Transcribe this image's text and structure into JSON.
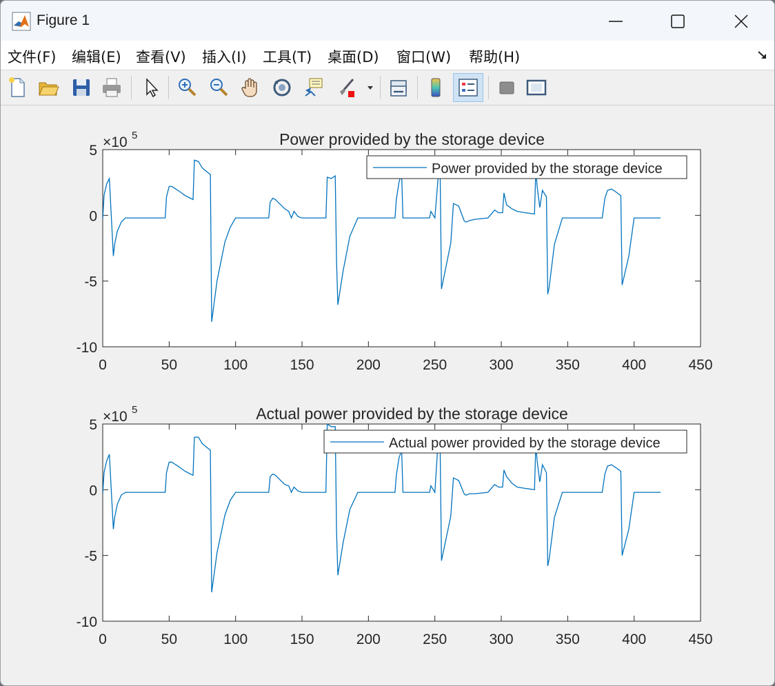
{
  "window": {
    "title": "Figure 1"
  },
  "menu": [
    "文件(F)",
    "编辑(E)",
    "查看(V)",
    "插入(I)",
    "工具(T)",
    "桌面(D)",
    "窗口(W)",
    "帮助(H)"
  ],
  "toolbar": [
    "new-figure-icon",
    "open-file-icon",
    "save-icon",
    "print-icon",
    "pointer-icon",
    "zoom-in-icon",
    "zoom-out-icon",
    "pan-icon",
    "rotate-3d-icon",
    "data-cursor-icon",
    "brush-icon",
    "link-plot-icon",
    "colorbar-icon",
    "legend-icon",
    "hide-plot-tools-icon",
    "show-plot-tools-icon"
  ],
  "colors": {
    "line": "#0072BD",
    "axes": "#262626"
  },
  "chart_data": [
    {
      "type": "line",
      "title": "Power provided by the storage device",
      "exponent_label": "×10",
      "exponent": "5",
      "legend": "top-right",
      "xlim": [
        0,
        450
      ],
      "ylim": [
        -10,
        5
      ],
      "xticks": [
        "0",
        "50",
        "100",
        "150",
        "200",
        "250",
        "300",
        "350",
        "400",
        "450"
      ],
      "yticks": [
        "-10",
        "-5",
        "0",
        "5"
      ],
      "series": [
        {
          "name": "Power provided by the storage device",
          "x": [
            0,
            1,
            2,
            3,
            5,
            8,
            9,
            11,
            14,
            17,
            20,
            30,
            40,
            47,
            48,
            50,
            52,
            55,
            58,
            62,
            66,
            68,
            69,
            72,
            75,
            81,
            82,
            86,
            92,
            96,
            100,
            110,
            120,
            125,
            126,
            128,
            130,
            133,
            137,
            140,
            142,
            144,
            147,
            150,
            160,
            168,
            169,
            172,
            175,
            176,
            177,
            181,
            186,
            192,
            200,
            210,
            220,
            221,
            223,
            225,
            226,
            230,
            240,
            246,
            247,
            250,
            253,
            254,
            255,
            262,
            264,
            266,
            268,
            272,
            273,
            274,
            276,
            280,
            290,
            295,
            298,
            301,
            302,
            304,
            308,
            312,
            318,
            325,
            326,
            327,
            329,
            331,
            334,
            335,
            336,
            340,
            346,
            350,
            360,
            370,
            376,
            378,
            380,
            383,
            386,
            390,
            391,
            396,
            400,
            410,
            420
          ],
          "y": [
            -0.3,
            1.5,
            2.0,
            2.4,
            2.8,
            -3.1,
            -2.2,
            -1.2,
            -0.5,
            -0.2,
            -0.2,
            -0.2,
            -0.2,
            -0.2,
            1.4,
            2.2,
            2.2,
            2.0,
            1.8,
            1.5,
            1.3,
            1.2,
            4.2,
            4.1,
            3.6,
            3.1,
            -8.1,
            -5.0,
            -2.0,
            -0.9,
            -0.2,
            -0.2,
            -0.2,
            -0.2,
            1.0,
            1.3,
            1.2,
            0.9,
            0.5,
            0.3,
            -0.2,
            0.3,
            -0.1,
            -0.2,
            -0.2,
            -0.2,
            2.9,
            2.8,
            3.0,
            -3.5,
            -6.8,
            -4.2,
            -1.6,
            -0.2,
            -0.2,
            -0.2,
            -0.2,
            1.2,
            2.5,
            3.2,
            -0.2,
            -0.2,
            -0.2,
            -0.2,
            0.3,
            -0.2,
            3.5,
            3.0,
            -5.6,
            -2.1,
            0.9,
            0.8,
            0.7,
            -0.4,
            -0.5,
            -0.5,
            -0.4,
            -0.3,
            -0.2,
            0.4,
            0.2,
            0.2,
            1.7,
            0.8,
            0.5,
            0.3,
            0.2,
            0.1,
            3.5,
            2.2,
            0.6,
            1.9,
            1.4,
            -6.0,
            -5.5,
            -2.2,
            -0.2,
            -0.2,
            -0.2,
            -0.2,
            -0.2,
            1.3,
            1.9,
            2.0,
            1.8,
            1.5,
            -5.3,
            -3.1,
            -0.2,
            -0.2,
            -0.2
          ]
        }
      ]
    },
    {
      "type": "line",
      "title": "Actual power provided by the storage device",
      "exponent_label": "×10",
      "exponent": "5",
      "legend": "top-right",
      "xlim": [
        0,
        450
      ],
      "ylim": [
        -10,
        5
      ],
      "xticks": [
        "0",
        "50",
        "100",
        "150",
        "200",
        "250",
        "300",
        "350",
        "400",
        "450"
      ],
      "yticks": [
        "-10",
        "-5",
        "0",
        "5"
      ],
      "series": [
        {
          "name": "Actual power provided by the storage device",
          "x": [
            0,
            1,
            2,
            3,
            5,
            8,
            9,
            11,
            14,
            17,
            20,
            30,
            40,
            47,
            48,
            50,
            52,
            55,
            58,
            62,
            66,
            68,
            69,
            72,
            75,
            81,
            82,
            86,
            92,
            96,
            100,
            110,
            120,
            125,
            126,
            128,
            130,
            133,
            137,
            140,
            142,
            144,
            147,
            150,
            160,
            168,
            169,
            172,
            175,
            176,
            177,
            181,
            186,
            192,
            200,
            210,
            220,
            221,
            223,
            225,
            226,
            230,
            240,
            246,
            247,
            250,
            253,
            254,
            255,
            262,
            264,
            266,
            268,
            272,
            273,
            274,
            276,
            280,
            290,
            295,
            298,
            301,
            302,
            304,
            308,
            312,
            318,
            325,
            326,
            327,
            329,
            331,
            334,
            335,
            336,
            340,
            346,
            350,
            360,
            370,
            376,
            378,
            380,
            383,
            386,
            390,
            391,
            396,
            400,
            410,
            420
          ],
          "y": [
            -0.3,
            1.3,
            1.8,
            2.2,
            2.7,
            -3.0,
            -2.1,
            -1.1,
            -0.4,
            -0.2,
            -0.2,
            -0.2,
            -0.2,
            -0.2,
            1.3,
            2.1,
            2.1,
            1.9,
            1.7,
            1.4,
            1.2,
            1.1,
            4.0,
            4.0,
            3.5,
            3.0,
            -7.8,
            -4.8,
            -1.9,
            -0.8,
            -0.2,
            -0.2,
            -0.2,
            -0.2,
            1.0,
            1.2,
            1.1,
            0.8,
            0.4,
            0.3,
            -0.2,
            0.2,
            -0.1,
            -0.2,
            -0.2,
            -0.2,
            5.0,
            4.8,
            4.8,
            -3.2,
            -6.5,
            -4.0,
            -1.5,
            -0.2,
            -0.2,
            -0.2,
            -0.2,
            1.1,
            2.4,
            3.0,
            -0.2,
            -0.2,
            -0.2,
            -0.2,
            0.3,
            -0.2,
            4.5,
            3.0,
            -5.4,
            -2.0,
            0.9,
            0.8,
            0.7,
            -0.3,
            -0.4,
            -0.4,
            -0.3,
            -0.3,
            -0.2,
            0.4,
            0.2,
            0.2,
            1.5,
            1.0,
            0.5,
            0.2,
            0.1,
            0.0,
            3.5,
            2.2,
            0.6,
            1.9,
            1.3,
            -5.8,
            -5.3,
            -2.1,
            -0.2,
            -0.2,
            -0.2,
            -0.2,
            -0.2,
            1.2,
            1.8,
            1.9,
            1.7,
            1.4,
            -5.0,
            -3.0,
            -0.2,
            -0.2,
            -0.2
          ]
        }
      ]
    }
  ]
}
